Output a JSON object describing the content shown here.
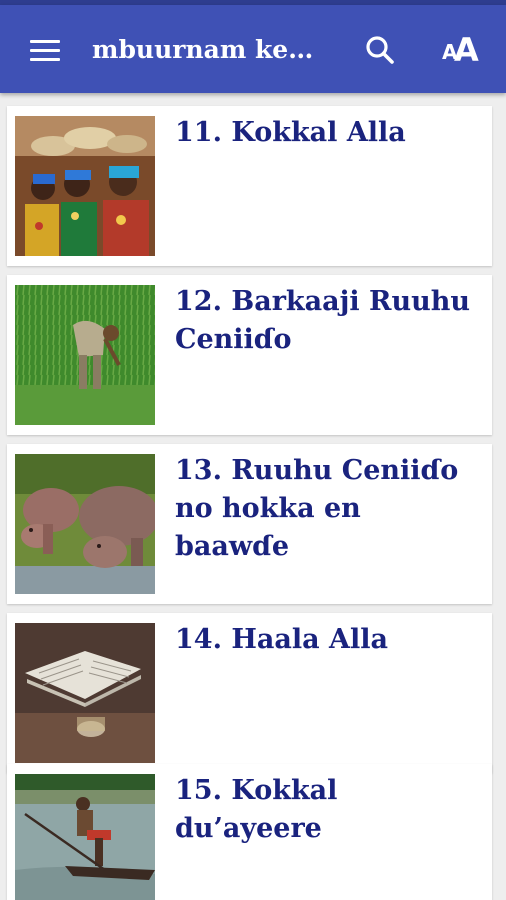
{
  "appbar": {
    "title": "mbuurnam ke…",
    "menu_icon": "hamburger-menu-icon",
    "search_icon": "search-icon",
    "font_icon": "font-size-icon",
    "font_small_glyph": "A",
    "font_big_glyph": "A"
  },
  "colors": {
    "appbar": "#3f51b5",
    "statusbar": "#2e3d8f",
    "title_text": "#1a237e",
    "background": "#eeeeee"
  },
  "lessons": [
    {
      "title": "11. Kokkal Alla",
      "image": "women-with-baskets-photo"
    },
    {
      "title": "12. Barkaaji Ruuhu Ceniiɗo",
      "image": "rice-field-farmer-photo"
    },
    {
      "title": "13. Ruuhu Ceniiɗo no hokka en baawɗe",
      "image": "hippopotamus-photo"
    },
    {
      "title": "14. Haala Alla",
      "image": "open-book-photo"
    },
    {
      "title": "15. Kokkal du’ayeere",
      "image": "fisherman-canoe-photo"
    }
  ]
}
